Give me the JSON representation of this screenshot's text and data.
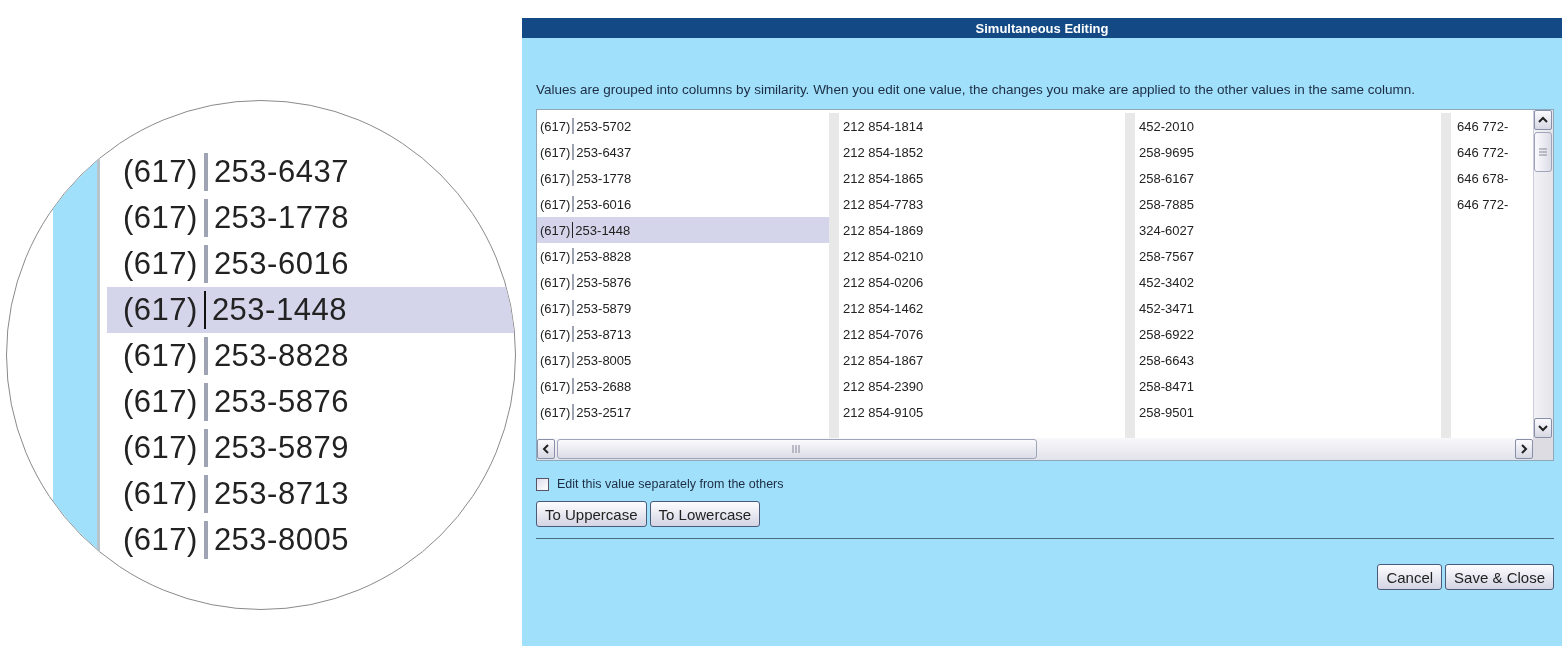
{
  "magnifier": {
    "rows": [
      {
        "area": "(617)",
        "number": "253-6437",
        "selected": false
      },
      {
        "area": "(617)",
        "number": "253-1778",
        "selected": false
      },
      {
        "area": "(617)",
        "number": "253-6016",
        "selected": false
      },
      {
        "area": "(617)",
        "number": "253-1448",
        "selected": true
      },
      {
        "area": "(617)",
        "number": "253-8828",
        "selected": false
      },
      {
        "area": "(617)",
        "number": "253-5876",
        "selected": false
      },
      {
        "area": "(617)",
        "number": "253-5879",
        "selected": false
      },
      {
        "area": "(617)",
        "number": "253-8713",
        "selected": false
      },
      {
        "area": "(617)",
        "number": "253-8005",
        "selected": false
      }
    ]
  },
  "window": {
    "title": "Simultaneous Editing"
  },
  "description": "Values are grouped into columns by similarity. When you edit one value, the changes you make are applied to the other values in the same column.",
  "first_column": [
    {
      "area": "(617)",
      "number": "253-5702",
      "selected": false
    },
    {
      "area": "(617)",
      "number": "253-6437",
      "selected": false
    },
    {
      "area": "(617)",
      "number": "253-1778",
      "selected": false
    },
    {
      "area": "(617)",
      "number": "253-6016",
      "selected": false
    },
    {
      "area": "(617)",
      "number": "253-1448",
      "selected": true
    },
    {
      "area": "(617)",
      "number": "253-8828",
      "selected": false
    },
    {
      "area": "(617)",
      "number": "253-5876",
      "selected": false
    },
    {
      "area": "(617)",
      "number": "253-5879",
      "selected": false
    },
    {
      "area": "(617)",
      "number": "253-8713",
      "selected": false
    },
    {
      "area": "(617)",
      "number": "253-8005",
      "selected": false
    },
    {
      "area": "(617)",
      "number": "253-2688",
      "selected": false
    },
    {
      "area": "(617)",
      "number": "253-2517",
      "selected": false
    }
  ],
  "other_columns": [
    [
      "212 854-1814",
      "212 854-1852",
      "212 854-1865",
      "212 854-7783",
      "212 854-1869",
      "212 854-0210",
      "212 854-0206",
      "212 854-1462",
      "212 854-7076",
      "212 854-1867",
      "212 854-2390",
      "212 854-9105"
    ],
    [
      "452-2010",
      "258-9695",
      "258-6167",
      "258-7885",
      "324-6027",
      "258-7567",
      "452-3402",
      "452-3471",
      "258-6922",
      "258-6643",
      "258-8471",
      "258-9501"
    ],
    [
      "646 772-",
      "646 772-",
      "646 678-",
      "646 772-"
    ]
  ],
  "separate_checkbox": {
    "label": "Edit this value separately from the others",
    "checked": false
  },
  "case_buttons": [
    "To Uppercase",
    "To Lowercase"
  ],
  "buttons": [
    "Cancel",
    "Save & Close"
  ]
}
